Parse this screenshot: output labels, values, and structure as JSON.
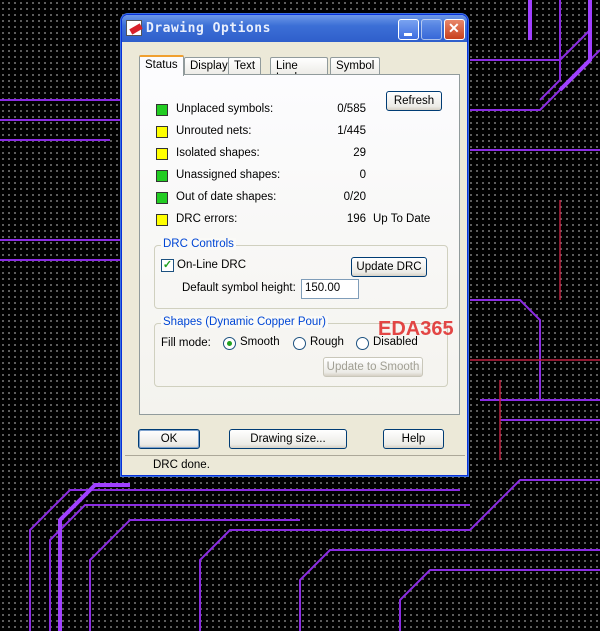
{
  "window": {
    "title": "Drawing Options"
  },
  "tabs": [
    {
      "label": "Status"
    },
    {
      "label": "Display"
    },
    {
      "label": "Text"
    },
    {
      "label": "Line Lock"
    },
    {
      "label": "Symbol"
    }
  ],
  "status": {
    "refresh_label": "Refresh",
    "rows": [
      {
        "label": "Unplaced symbols:",
        "value": "0/585",
        "color": "#22cc22"
      },
      {
        "label": "Unrouted nets:",
        "value": "1/445",
        "color": "#ffff00"
      },
      {
        "label": "Isolated shapes:",
        "value": "29",
        "color": "#ffff00"
      },
      {
        "label": "Unassigned shapes:",
        "value": "0",
        "color": "#22cc22"
      },
      {
        "label": "Out of date shapes:",
        "value": "0/20",
        "color": "#22cc22"
      },
      {
        "label": "DRC errors:",
        "value": "196",
        "extra": "Up To Date",
        "color": "#ffff00"
      }
    ]
  },
  "drc": {
    "group_title": "DRC Controls",
    "online_label": "On-Line DRC",
    "online_checked": true,
    "update_label": "Update DRC",
    "height_label": "Default symbol height:",
    "height_value": "150.00"
  },
  "shapes": {
    "group_title": "Shapes (Dynamic Copper Pour)",
    "fill_label": "Fill mode:",
    "options": [
      "Smooth",
      "Rough",
      "Disabled"
    ],
    "selected": "Smooth",
    "update_label": "Update to Smooth"
  },
  "buttons": {
    "ok": "OK",
    "drawing_size": "Drawing size...",
    "help": "Help"
  },
  "statusbar": "DRC done.",
  "watermark": "EDA365"
}
